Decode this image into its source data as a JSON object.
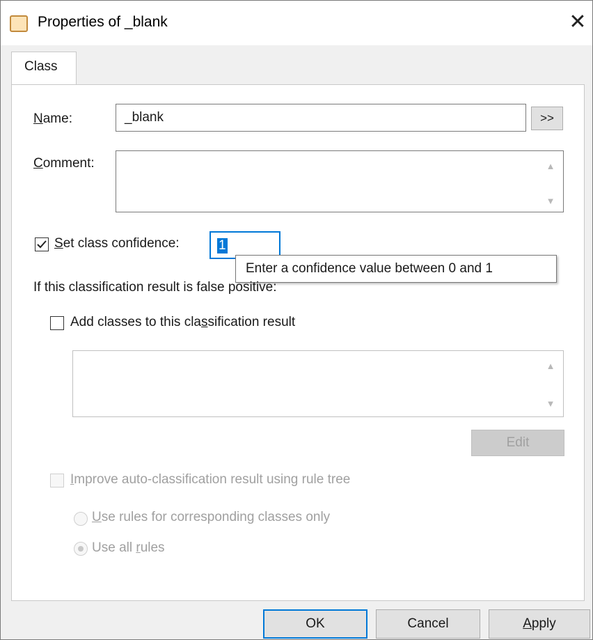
{
  "window": {
    "title": "Properties of _blank",
    "close_symbol": "✕"
  },
  "tabs": [
    {
      "label": "Class"
    }
  ],
  "name": {
    "label": "Name:",
    "value": "_blank",
    "more_button": ">>"
  },
  "comment": {
    "label": "Comment:",
    "value": ""
  },
  "confidence": {
    "checked": true,
    "label": "Set class confidence:",
    "value": "1"
  },
  "tooltip": {
    "text": "Enter a confidence value between 0 and 1"
  },
  "false_positive": {
    "heading": "If this classification result is false positive:",
    "add_classes": {
      "checked": false,
      "label": "Add classes to this classification result"
    },
    "edit_button": "Edit"
  },
  "improve": {
    "checked": false,
    "label": "Improve auto-classification result using rule tree",
    "options": [
      {
        "label": "Use rules for corresponding classes only",
        "selected": false
      },
      {
        "label": "Use all rules",
        "selected": true
      }
    ]
  },
  "footer": {
    "ok": "OK",
    "cancel": "Cancel",
    "apply": "Apply"
  },
  "colors": {
    "accent": "#0078d7",
    "disabled_text": "#a0a0a0",
    "selection": "#0078d7"
  }
}
